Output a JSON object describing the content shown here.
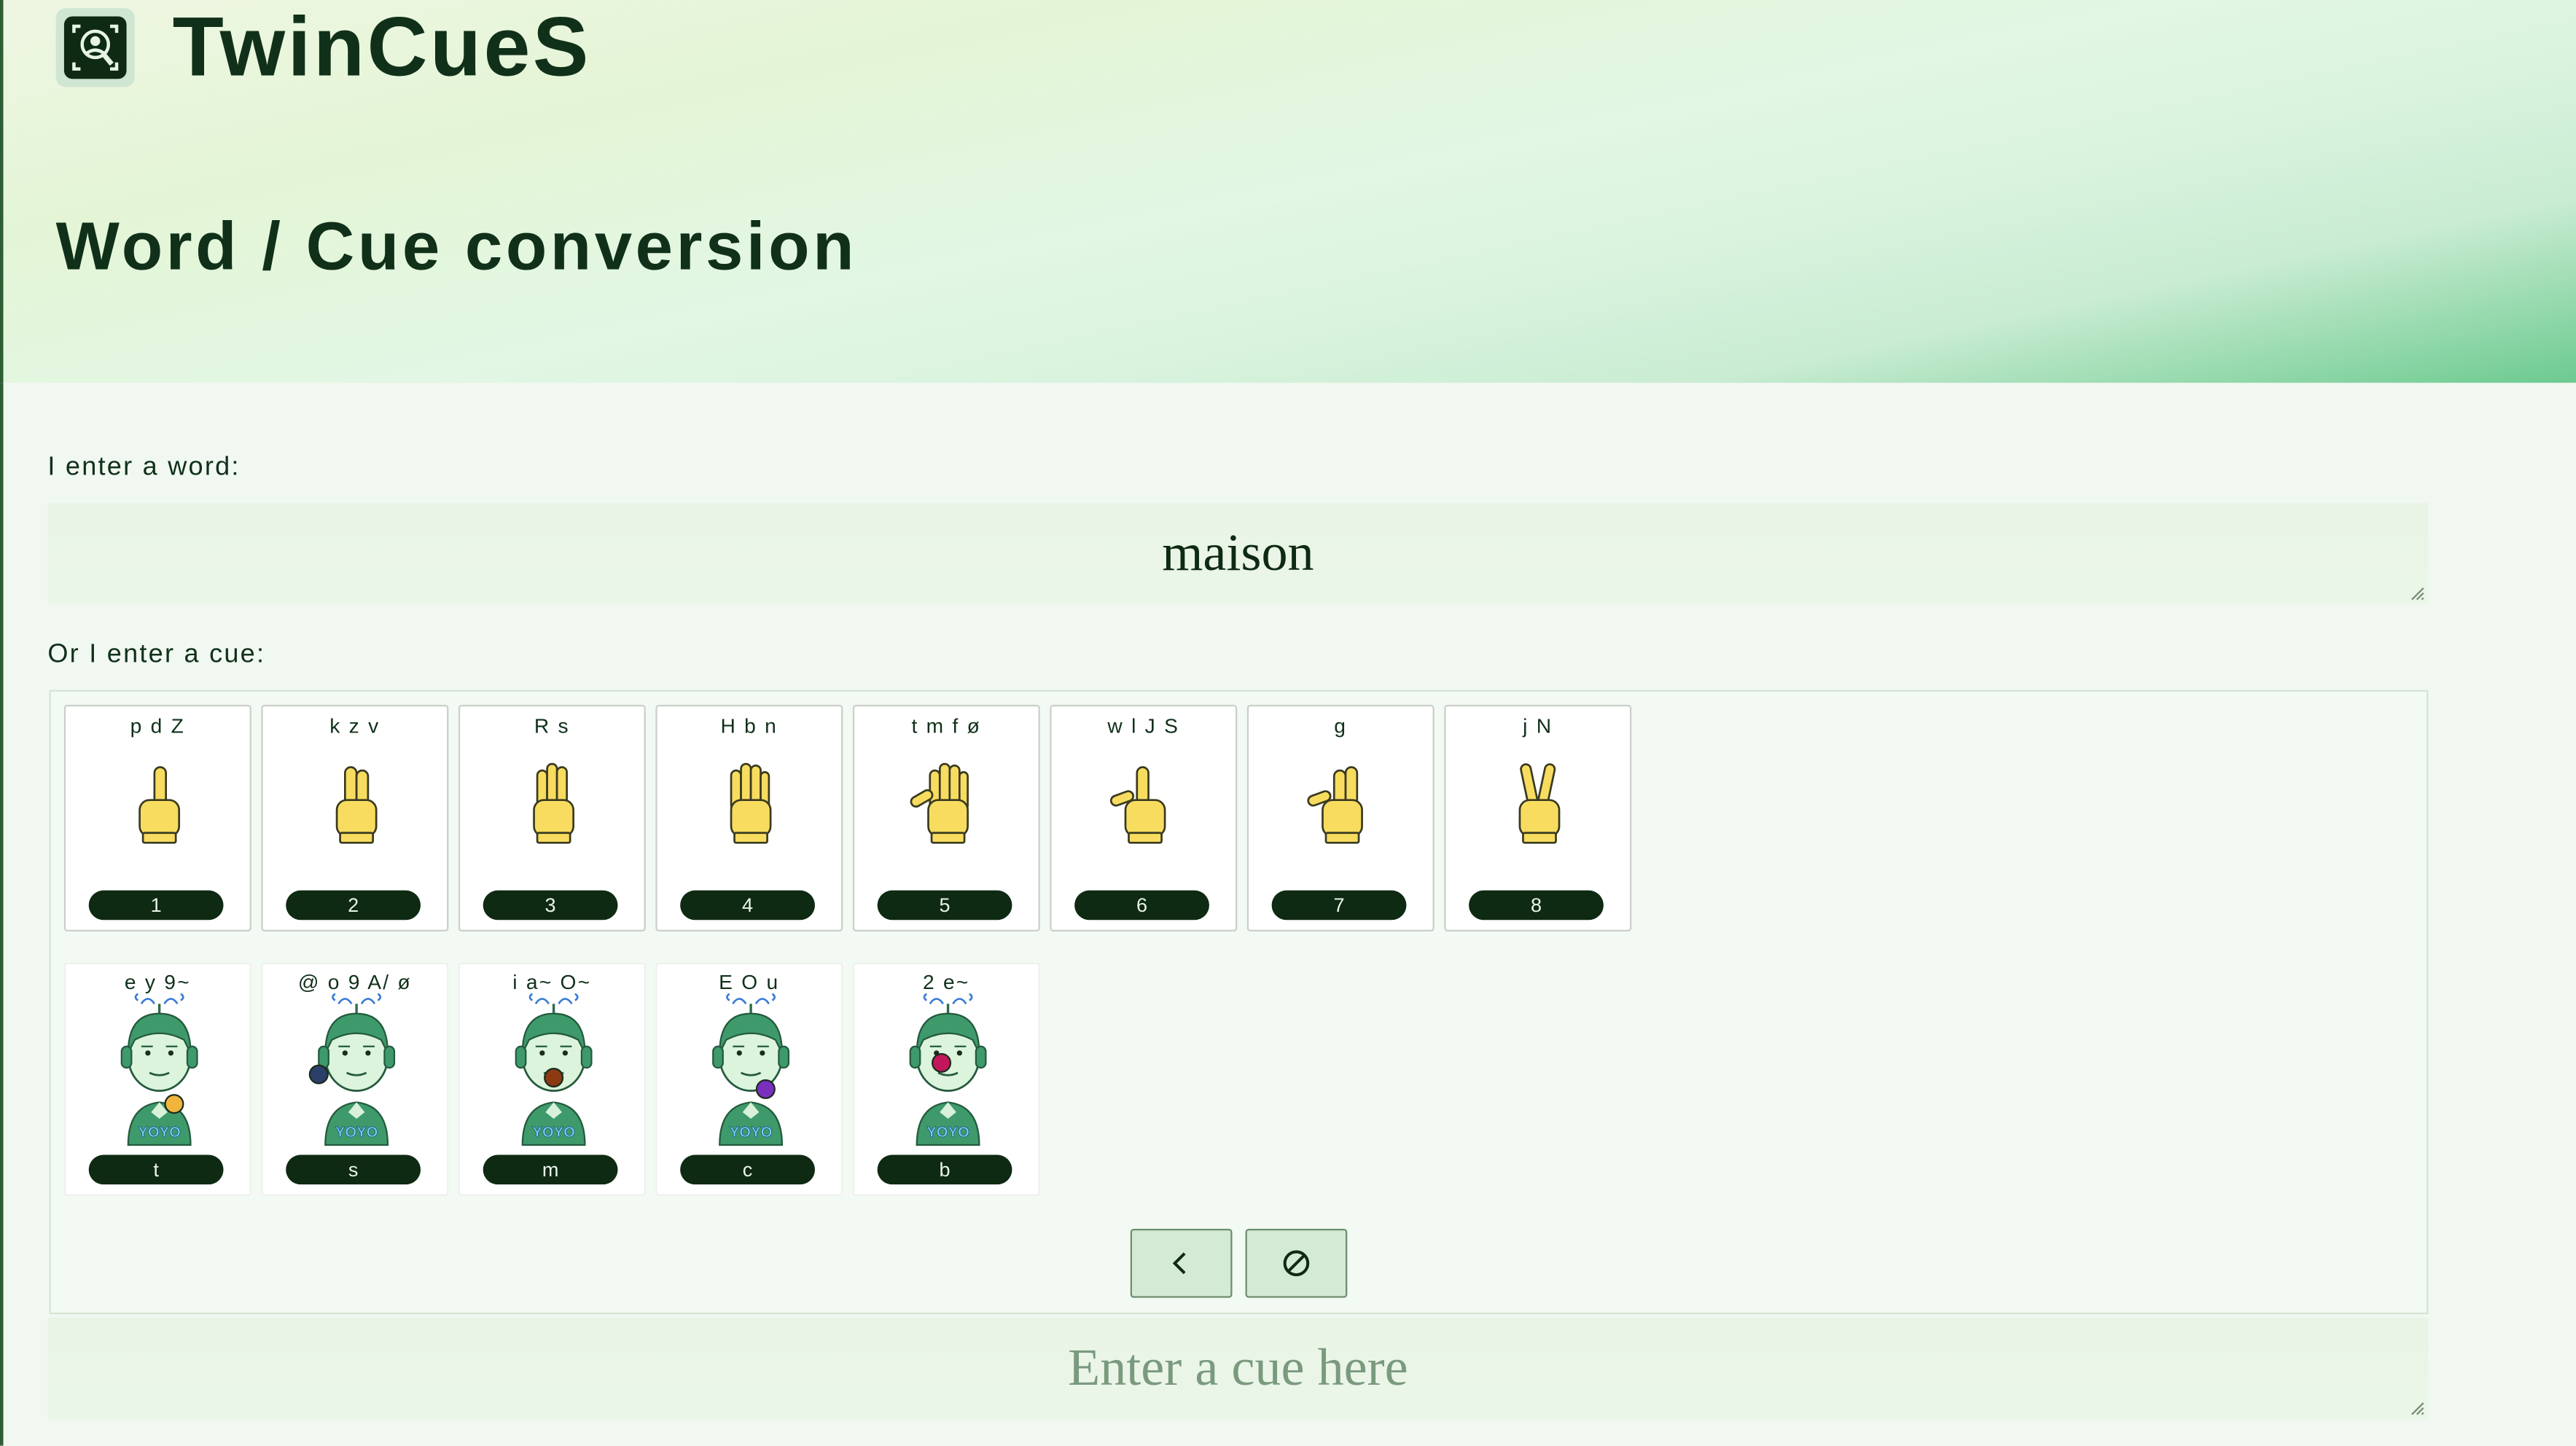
{
  "app": {
    "title": "TwinCueS",
    "logo_icon": "face-search-icon"
  },
  "page": {
    "title": "Word / Cue conversion"
  },
  "word_section": {
    "label": "I enter a word:",
    "value": "maison"
  },
  "cue_section": {
    "label": "Or I enter a cue:"
  },
  "hand_shapes": [
    {
      "phonemes": "p d Z",
      "key": "1"
    },
    {
      "phonemes": "k z v",
      "key": "2"
    },
    {
      "phonemes": "R s",
      "key": "3"
    },
    {
      "phonemes": "H b n",
      "key": "4"
    },
    {
      "phonemes": "t m f ø",
      "key": "5"
    },
    {
      "phonemes": "w l J S",
      "key": "6"
    },
    {
      "phonemes": "g",
      "key": "7"
    },
    {
      "phonemes": "j N",
      "key": "8"
    }
  ],
  "positions": [
    {
      "phonemes": "e y 9~",
      "key": "t",
      "dot_color": "#f1b53c"
    },
    {
      "phonemes": "@ o 9 A/ ø",
      "key": "s",
      "dot_color": "#2b3f6b"
    },
    {
      "phonemes": "i a~ O~",
      "key": "m",
      "dot_color": "#8b3a12"
    },
    {
      "phonemes": "E O u",
      "key": "c",
      "dot_color": "#7b2fbf"
    },
    {
      "phonemes": "2 e~",
      "key": "b",
      "dot_color": "#c2185b"
    }
  ],
  "shirt_text": "YOYO",
  "controls": {
    "back_icon": "chevron-left-icon",
    "clear_icon": "no-entry-icon"
  },
  "cue_input": {
    "placeholder": "Enter a cue here"
  },
  "colors": {
    "accent": "#0e2a12",
    "hand_fill": "#f7dc5f",
    "avatar_green": "#3e9a6a"
  }
}
